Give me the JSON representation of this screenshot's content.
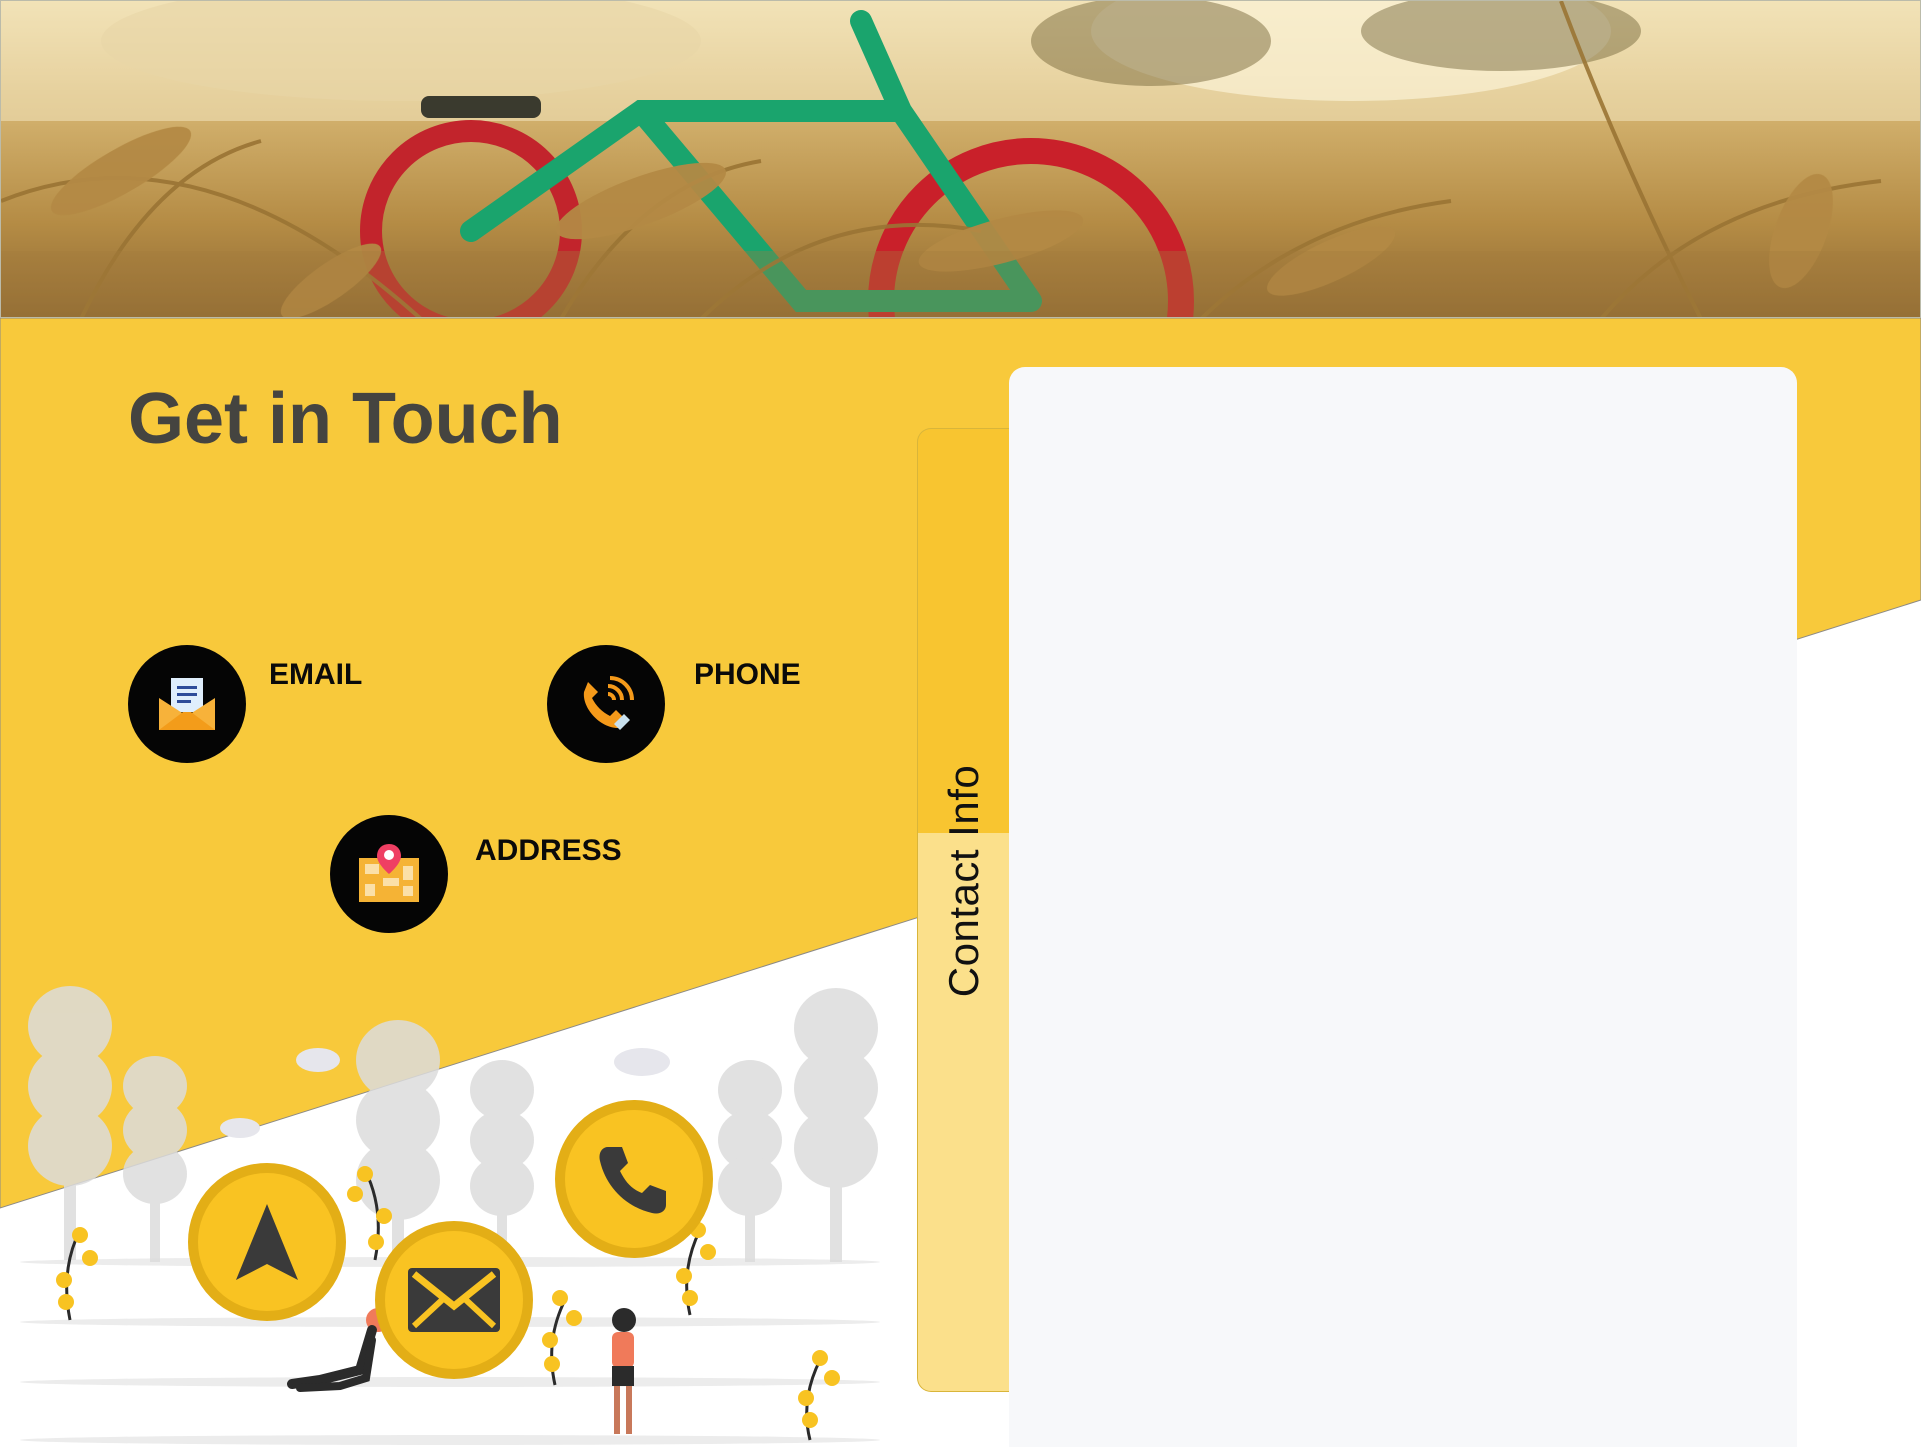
{
  "hero": {
    "image": "bicycle-in-wheat-field-photo"
  },
  "heading": {
    "title": "Get in Touch"
  },
  "contacts": {
    "email": {
      "label": "EMAIL",
      "icon": "envelope-letter-icon"
    },
    "phone": {
      "label": "PHONE",
      "icon": "ringing-phone-icon"
    },
    "address": {
      "label": "ADDRESS",
      "icon": "map-pin-icon"
    }
  },
  "tab": {
    "label": "Contact Info"
  },
  "illustration": {
    "buttons": [
      "navigation-arrow-icon",
      "mail-icon",
      "phone-icon"
    ]
  },
  "colors": {
    "accent_yellow": "#f8c93b",
    "dark_text": "#454440",
    "panel_bg": "#f7f8fa",
    "tab_light": "#fbe08b"
  }
}
